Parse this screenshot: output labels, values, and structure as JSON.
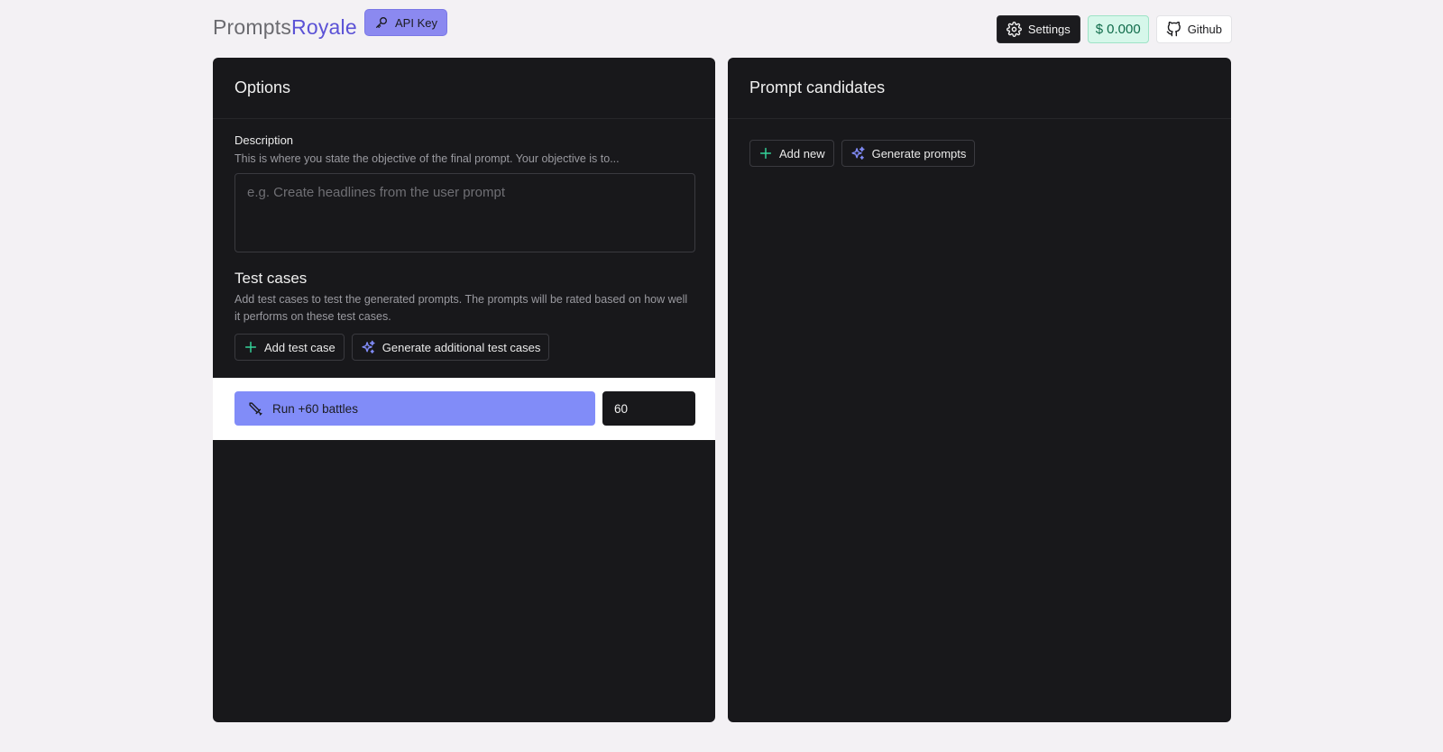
{
  "header": {
    "logo_prefix": "Prompts",
    "logo_accent": "Royale",
    "api_key_label": "API Key",
    "settings_label": "Settings",
    "cost_symbol": "$",
    "cost_value": "0.000",
    "github_label": "Github"
  },
  "options": {
    "title": "Options",
    "description_label": "Description",
    "description_help": "This is where you state the objective of the final prompt. Your objective is to...",
    "description_placeholder": "e.g. Create headlines from the user prompt",
    "test_cases_title": "Test cases",
    "test_cases_help": "Add test cases to test the generated prompts. The prompts will be rated based on how well it performs on these test cases.",
    "add_test_case_label": "Add test case",
    "generate_test_cases_label": "Generate additional test cases",
    "run_label": "Run +60 battles",
    "battles_value": "60"
  },
  "candidates": {
    "title": "Prompt candidates",
    "add_new_label": "Add new",
    "generate_prompts_label": "Generate prompts"
  },
  "colors": {
    "accent": "#818cf8",
    "logo_accent": "#5b52d6",
    "plus_green": "#34d399",
    "panel_bg": "#18181b",
    "page_bg": "#f3f1f4"
  },
  "icons": {
    "api_key": "key-icon",
    "settings": "gear-icon",
    "github": "github-icon",
    "add": "plus-icon",
    "generate": "sparkles-icon",
    "run": "sword-icon"
  }
}
